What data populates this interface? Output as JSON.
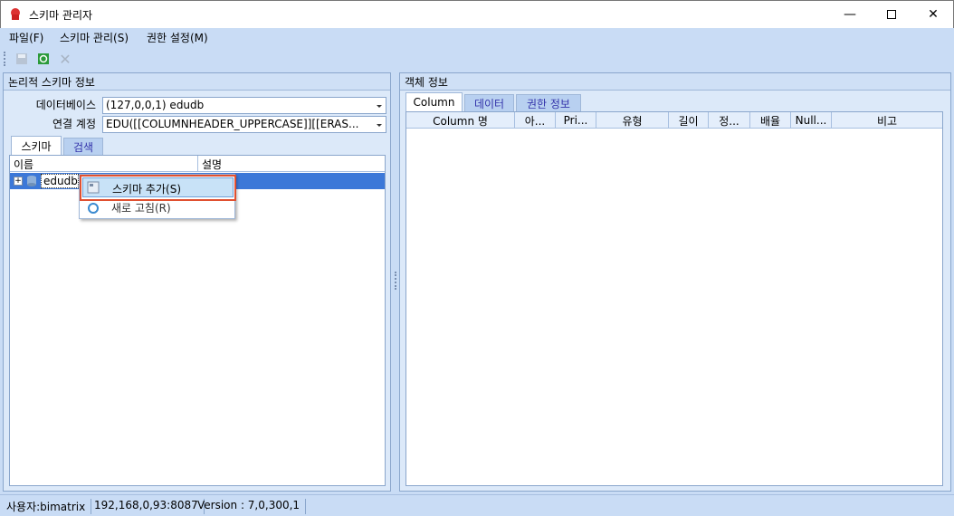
{
  "window": {
    "title": "스키마 관리자"
  },
  "menu": {
    "items": [
      {
        "label": "파일(F)"
      },
      {
        "label": "스키마 관리(S)"
      },
      {
        "label": "권한 설정(M)"
      }
    ]
  },
  "toolbar": {
    "buttons": [
      {
        "icon": "save-icon"
      },
      {
        "icon": "refresh-icon"
      },
      {
        "icon": "delete-icon"
      }
    ]
  },
  "left_panel": {
    "title": "논리적 스키마 정보",
    "db_label": "데이터베이스",
    "db_value": "(127,0,0,1) edudb",
    "account_label": "연결 계정",
    "account_value": "EDU([[COLUMNHEADER_UPPERCASE]][[ERAS...",
    "tabs": [
      {
        "label": "스키마"
      },
      {
        "label": "검색"
      }
    ],
    "columns": [
      {
        "label": "이름"
      },
      {
        "label": "설명"
      }
    ],
    "tree": [
      {
        "label": "edudb"
      }
    ]
  },
  "context_menu": {
    "items": [
      {
        "label": "스키마 추가(S)"
      },
      {
        "label": "새로 고침(R)"
      }
    ]
  },
  "right_panel": {
    "title": "객체 정보",
    "tabs": [
      {
        "label": "Column"
      },
      {
        "label": "데이터"
      },
      {
        "label": "권한 정보"
      }
    ],
    "columns": [
      {
        "label": "Column 명"
      },
      {
        "label": "아..."
      },
      {
        "label": "Pri..."
      },
      {
        "label": "유형"
      },
      {
        "label": "길이"
      },
      {
        "label": "정..."
      },
      {
        "label": "배율"
      },
      {
        "label": "Null..."
      },
      {
        "label": "비고"
      }
    ]
  },
  "status": {
    "user": "사용자:bimatrix",
    "server": "192,168,0,93:8087",
    "version": "Version : 7,0,300,1"
  }
}
